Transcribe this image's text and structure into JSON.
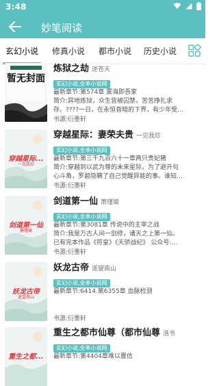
{
  "status": {
    "time": "3:48"
  },
  "header": {
    "title": "妙笔阅读",
    "color": "#5cc0c0"
  },
  "tabs": [
    {
      "label": "玄幻小说",
      "active": true
    },
    {
      "label": "修真小说",
      "active": false
    },
    {
      "label": "都市小说",
      "active": false
    },
    {
      "label": "历史小说",
      "active": false
    }
  ],
  "books": [
    {
      "title": "炼狱之劫",
      "author": "逆苍天",
      "tag": "玄幻小说,全本小说网",
      "latest": "最新章节:第574章 雾海即吾家",
      "intro1": "简介:异地炼狱，众生皆被囚禁，苦苦挣扎求",
      "intro2": "存。????一日，在永恒昏暗的下界，有少年受…",
      "source": "书源:衍墨轩",
      "cover_text": "暂无封面"
    },
    {
      "title": "穿越星际：妻荣夫贵",
      "author": "一见我珍",
      "tag": "玄幻小说,全本小说网",
      "latest": "最新章节:第三千九百六十一章两只贵妃猪",
      "intro1": "简介:穿越到以武为尊的未来星际，为了避开句",
      "intro2": "心斗角，罗碧隐瞒了自己觉醒异能的事。谁知…",
      "source": "书源:衍墨轩",
      "cover_text": "穿越星际...",
      "cover_sub": "一见我珍"
    },
    {
      "title": "剑道第一仙",
      "author": "萧瑾瑜",
      "tag": "玄幻小说,全本小说网",
      "latest": "最新章节:第3081章 传说中的主宰之战",
      "intro1": "简介:我是万古人间一剑修，诸天之上第一仙。",
      "intro2": "已有完本作品《符皇》《天骄战纪》 公众号:…",
      "source": "书源:衍墨轩",
      "cover_text": "剑道第一仙",
      "cover_sub": "萧瑾瑜"
    },
    {
      "title": "妖龙古帝",
      "author": "遥望南山",
      "tag": "玄幻小说,全本小说网",
      "latest": "最新章节:6414.第6355章 血脉检测",
      "intro1": "",
      "intro2": "",
      "source": "书源:衍墨轩",
      "cover_text": "妖龙古帝",
      "cover_sub": "遥望南山"
    },
    {
      "title": "重生之都市仙尊（都市仙尊",
      "author": "洛书",
      "tag": "玄幻小说,全本小说网",
      "latest": "最新章节:第4404章难以置信",
      "intro1": "",
      "intro2": "",
      "source": "",
      "cover_text": "重生之都..."
    }
  ]
}
